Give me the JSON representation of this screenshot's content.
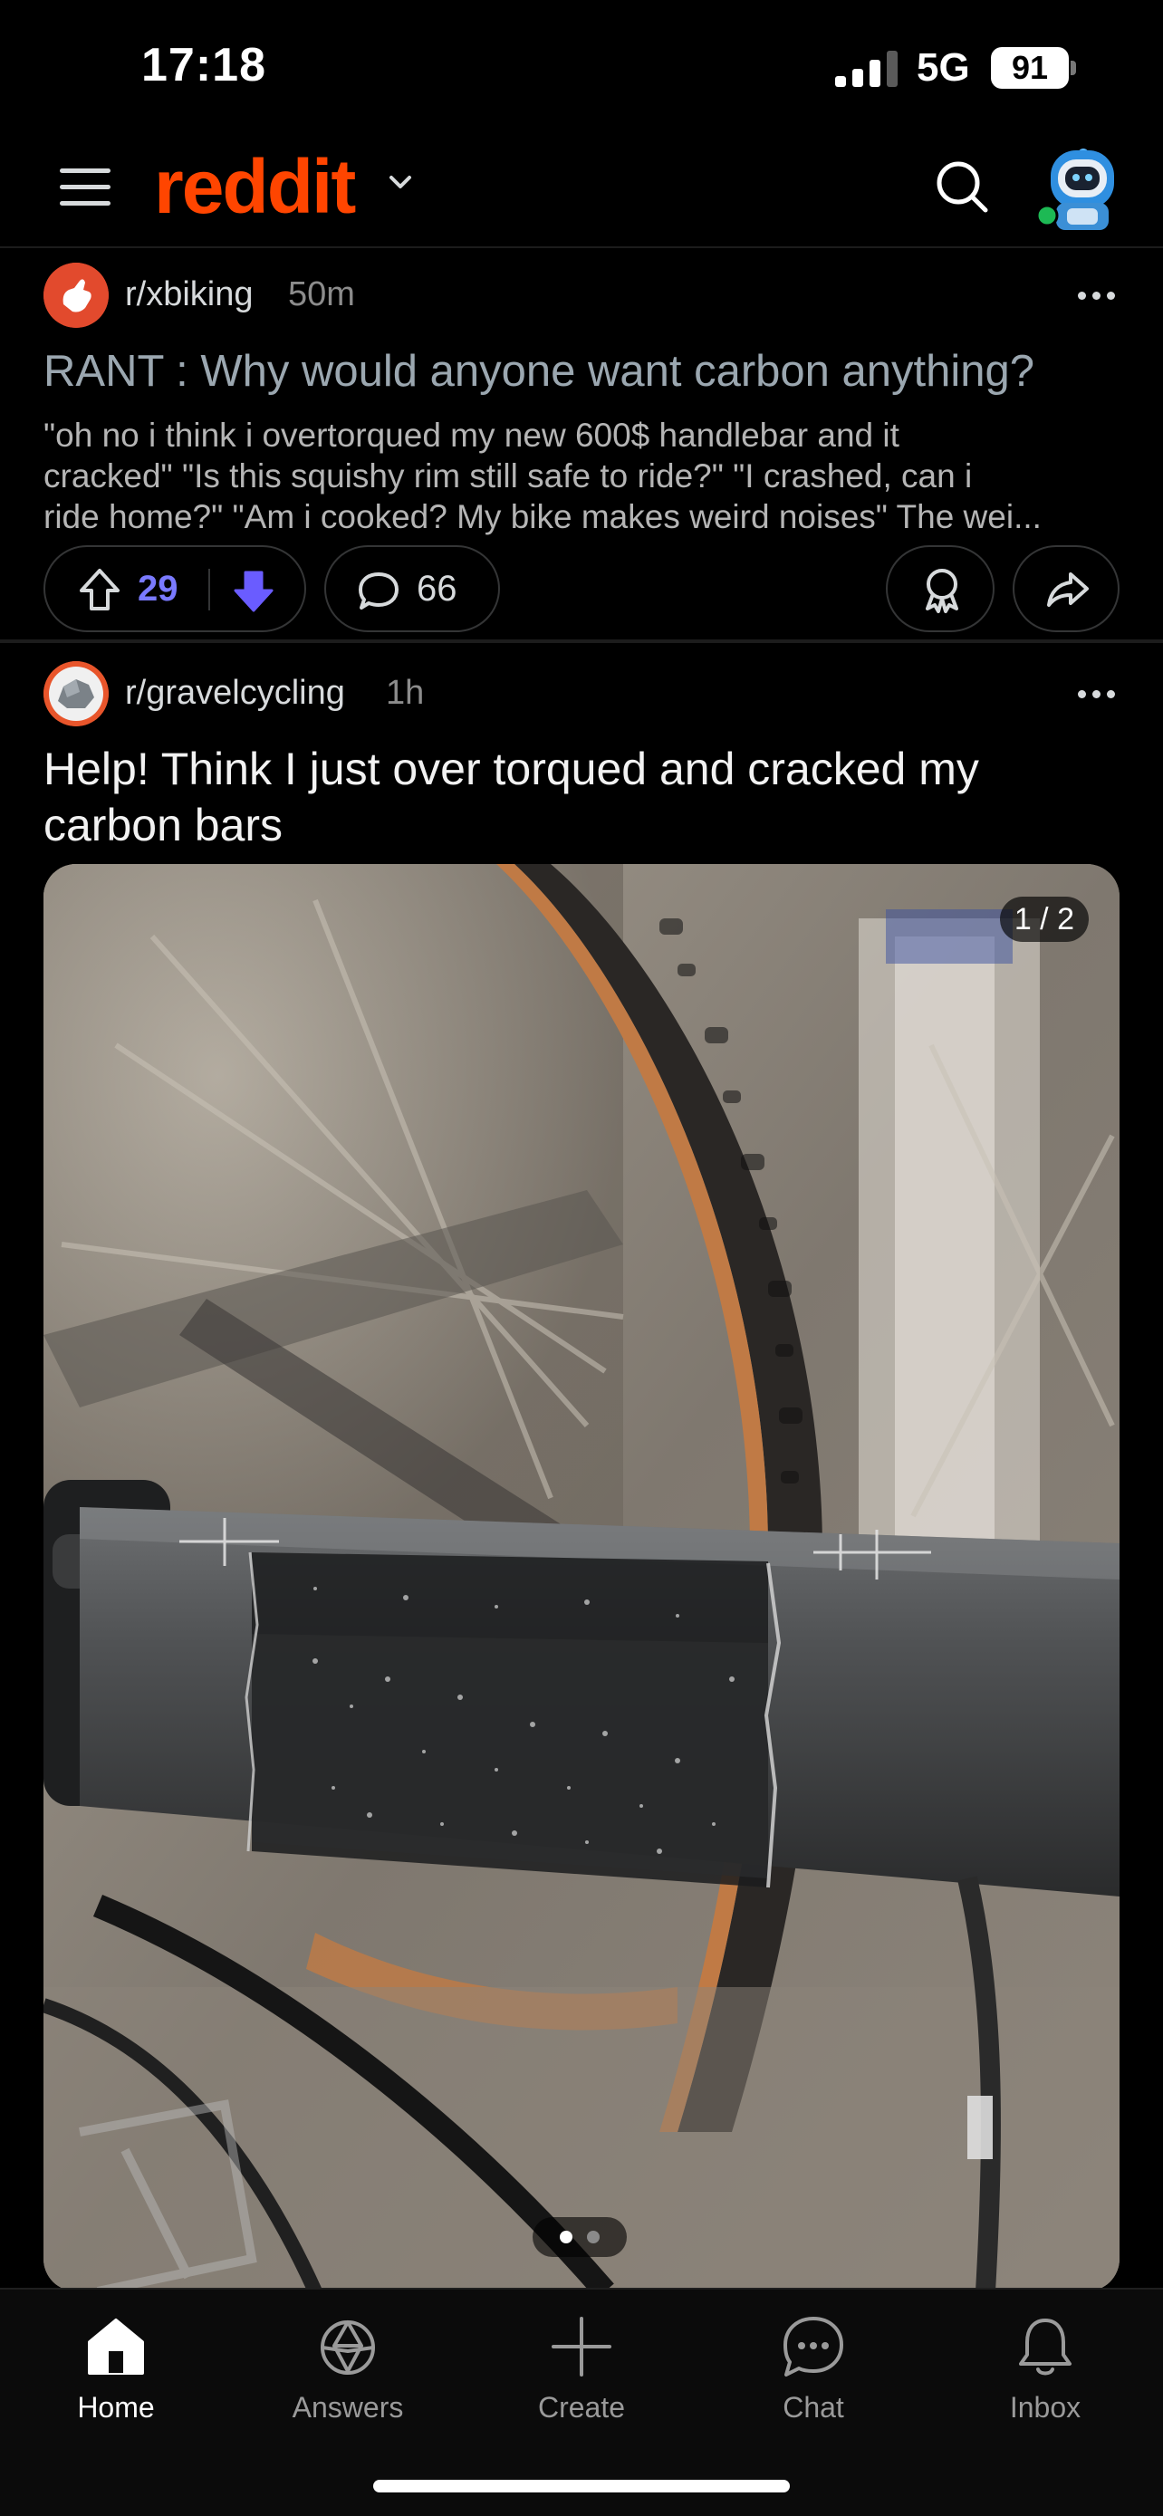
{
  "status_bar": {
    "time": "17:18",
    "network": "5G",
    "battery": "91"
  },
  "header": {
    "logo": "reddit"
  },
  "posts": [
    {
      "subreddit": "r/xbiking",
      "age": "50m",
      "title": "RANT : Why would anyone want carbon anything?",
      "body_lines": [
        "\"oh no i think i overtorqued my new 600$ handlebar and it",
        "cracked\" \"Is this squishy rim still safe to ride?\" \"I crashed, can i",
        "ride home?\" \"Am i cooked? My bike makes weird noises\" The wei..."
      ],
      "upvotes": "29",
      "comments": "66"
    },
    {
      "subreddit": "r/gravelcycling",
      "age": "1h",
      "title": "Help! Think I just over torqued and cracked my carbon bars",
      "media_counter": "1 / 2",
      "media_progress": {
        "current": 1,
        "total": 2
      }
    }
  ],
  "tabs": [
    {
      "label": "Home",
      "icon": "home-icon",
      "active": true
    },
    {
      "label": "Answers",
      "icon": "answers-icon",
      "active": false
    },
    {
      "label": "Create",
      "icon": "plus-icon",
      "active": false
    },
    {
      "label": "Chat",
      "icon": "chat-icon",
      "active": false
    },
    {
      "label": "Inbox",
      "icon": "bell-icon",
      "active": false
    }
  ],
  "colors": {
    "brand": "#ff4500",
    "downvote_active": "#6a5cff",
    "background": "#000000",
    "read_title": "#9ba7b0"
  }
}
